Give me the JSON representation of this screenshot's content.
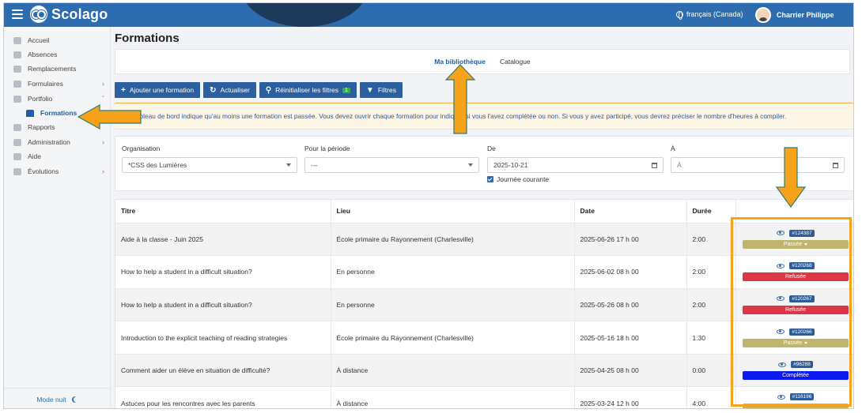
{
  "app": {
    "logo_text": "Scolago",
    "language": "français (Canada)",
    "user_name": "Charrier Philippe"
  },
  "sidebar": {
    "items": [
      {
        "label": "Accueil",
        "icon": "home-icon",
        "chevron": false
      },
      {
        "label": "Absences",
        "icon": "person-minus-icon",
        "chevron": false
      },
      {
        "label": "Remplacements",
        "icon": "swap-icon",
        "chevron": false
      },
      {
        "label": "Formulaires",
        "icon": "form-icon",
        "chevron": true
      },
      {
        "label": "Portfolio",
        "icon": "trophy-icon",
        "chevron": true
      },
      {
        "label": "Formations",
        "icon": "graduation-cap-icon",
        "chevron": false,
        "active": true
      },
      {
        "label": "Rapports",
        "icon": "report-icon",
        "chevron": false
      },
      {
        "label": "Administration",
        "icon": "gear-icon",
        "chevron": true
      },
      {
        "label": "Aide",
        "icon": "question-icon",
        "chevron": false
      },
      {
        "label": "Évolutions",
        "icon": "sprout-icon",
        "chevron": true
      }
    ],
    "night_mode": "Mode nuit"
  },
  "page": {
    "title": "Formations"
  },
  "tabs": [
    {
      "label": "Ma bibliothèque",
      "active": true
    },
    {
      "label": "Catalogue",
      "active": false
    }
  ],
  "toolbar": {
    "add": "Ajouter une formation",
    "refresh": "Actualiser",
    "reset": "Réinitialiser les filtres",
    "reset_count": "1",
    "filters": "Filtres"
  },
  "alert": {
    "text": "otre tableau de bord indique qu'au moins une formation est passée. Vous devez ouvrir chaque formation pour indiquer si vous l'avez complétée ou non. Si vous y avez participé, vous devrez préciser le nombre d'heures à compiler."
  },
  "filters": {
    "org_label": "Organisation",
    "org_value": "*CSS des Lumières",
    "period_label": "Pour la période",
    "period_value": "---",
    "from_label": "De",
    "from_value": "2025-10-21",
    "to_label": "À",
    "to_placeholder": "À",
    "current_day_label": "Journée courante"
  },
  "table": {
    "headers": {
      "title": "Titre",
      "place": "Lieu",
      "date": "Date",
      "duration": "Durée"
    },
    "rows": [
      {
        "title": "Aide à la classe - Juin 2025",
        "place": "École primaire du Rayonnement (Charlesville)",
        "date": "2025-06-26 17 h 00",
        "duration": "2:00",
        "id": "#124387",
        "status": "Passée",
        "status_color": "#bfb56c"
      },
      {
        "title": "How to help a student in a difficult situation?",
        "place": "En personne",
        "date": "2025-06-02 08 h 00",
        "duration": "2:00",
        "id": "#120268",
        "status": "Refusée",
        "status_color": "#dc3545"
      },
      {
        "title": "How to help a student in a difficult situation?",
        "place": "En personne",
        "date": "2025-05-26 08 h 00",
        "duration": "2:00",
        "id": "#120267",
        "status": "Refusée",
        "status_color": "#dc3545"
      },
      {
        "title": "Introduction to the explicit teaching of reading strategies",
        "place": "École primaire du Rayonnement (Charlesville)",
        "date": "2025-05-16 18 h 00",
        "duration": "1:30",
        "id": "#120266",
        "status": "Passée",
        "status_color": "#bfb56c"
      },
      {
        "title": "Comment aider un élève en situation de difficulté?",
        "place": "À distance",
        "date": "2025-04-25 08 h 00",
        "duration": "0:00",
        "id": "#96288",
        "status": "Complétée",
        "status_color": "#0b1bf0"
      },
      {
        "title": "Astuces pour les rencontres avec les parents",
        "place": "À distance",
        "date": "2025-03-24 12 h 00",
        "duration": "4:00",
        "id": "#116196",
        "status": "",
        "status_color": "#bfb56c"
      }
    ]
  },
  "colors": {
    "topbar": "#2d6cae",
    "primary": "#2b5f9f",
    "annotation": "#f7a21b"
  }
}
